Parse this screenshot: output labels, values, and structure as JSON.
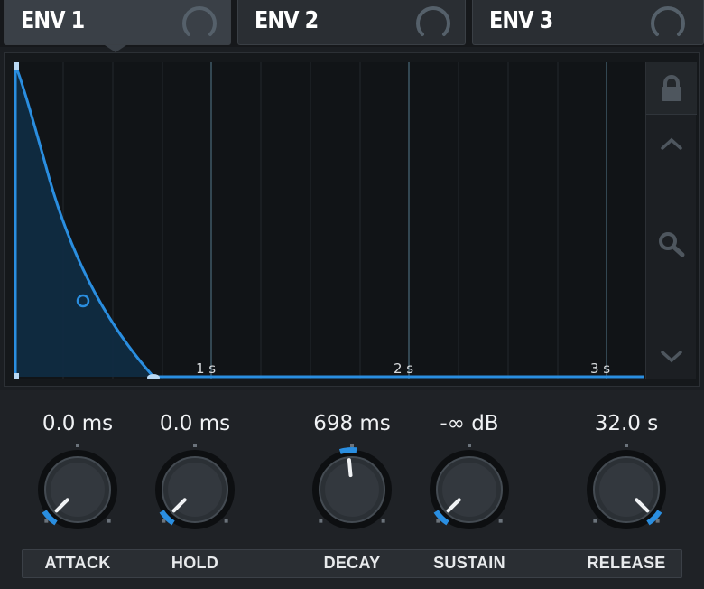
{
  "tabs": [
    {
      "label": "ENV 1",
      "active": true
    },
    {
      "label": "ENV 2",
      "active": false
    },
    {
      "label": "ENV 3",
      "active": false
    }
  ],
  "graph": {
    "time_markers": [
      "1 s",
      "2 s",
      "3 s"
    ],
    "curve_color": "#2a8ee0",
    "fill_color": "#0f2c44"
  },
  "side_icons": [
    "lock-icon",
    "chevron-up-icon",
    "zoom-icon",
    "chevron-down-icon"
  ],
  "knobs": [
    {
      "label": "ATTACK",
      "value": "0.0 ms",
      "fraction": 0.0
    },
    {
      "label": "HOLD",
      "value": "0.0 ms",
      "fraction": 0.0
    },
    {
      "label": "DECAY",
      "value": "698 ms",
      "fraction": 0.48
    },
    {
      "label": "SUSTAIN",
      "value": "-∞ dB",
      "fraction": 0.0
    },
    {
      "label": "RELEASE",
      "value": "32.0 s",
      "fraction": 1.0
    }
  ],
  "colors": {
    "accent": "#2a8ee0",
    "background": "#1b1e22"
  }
}
